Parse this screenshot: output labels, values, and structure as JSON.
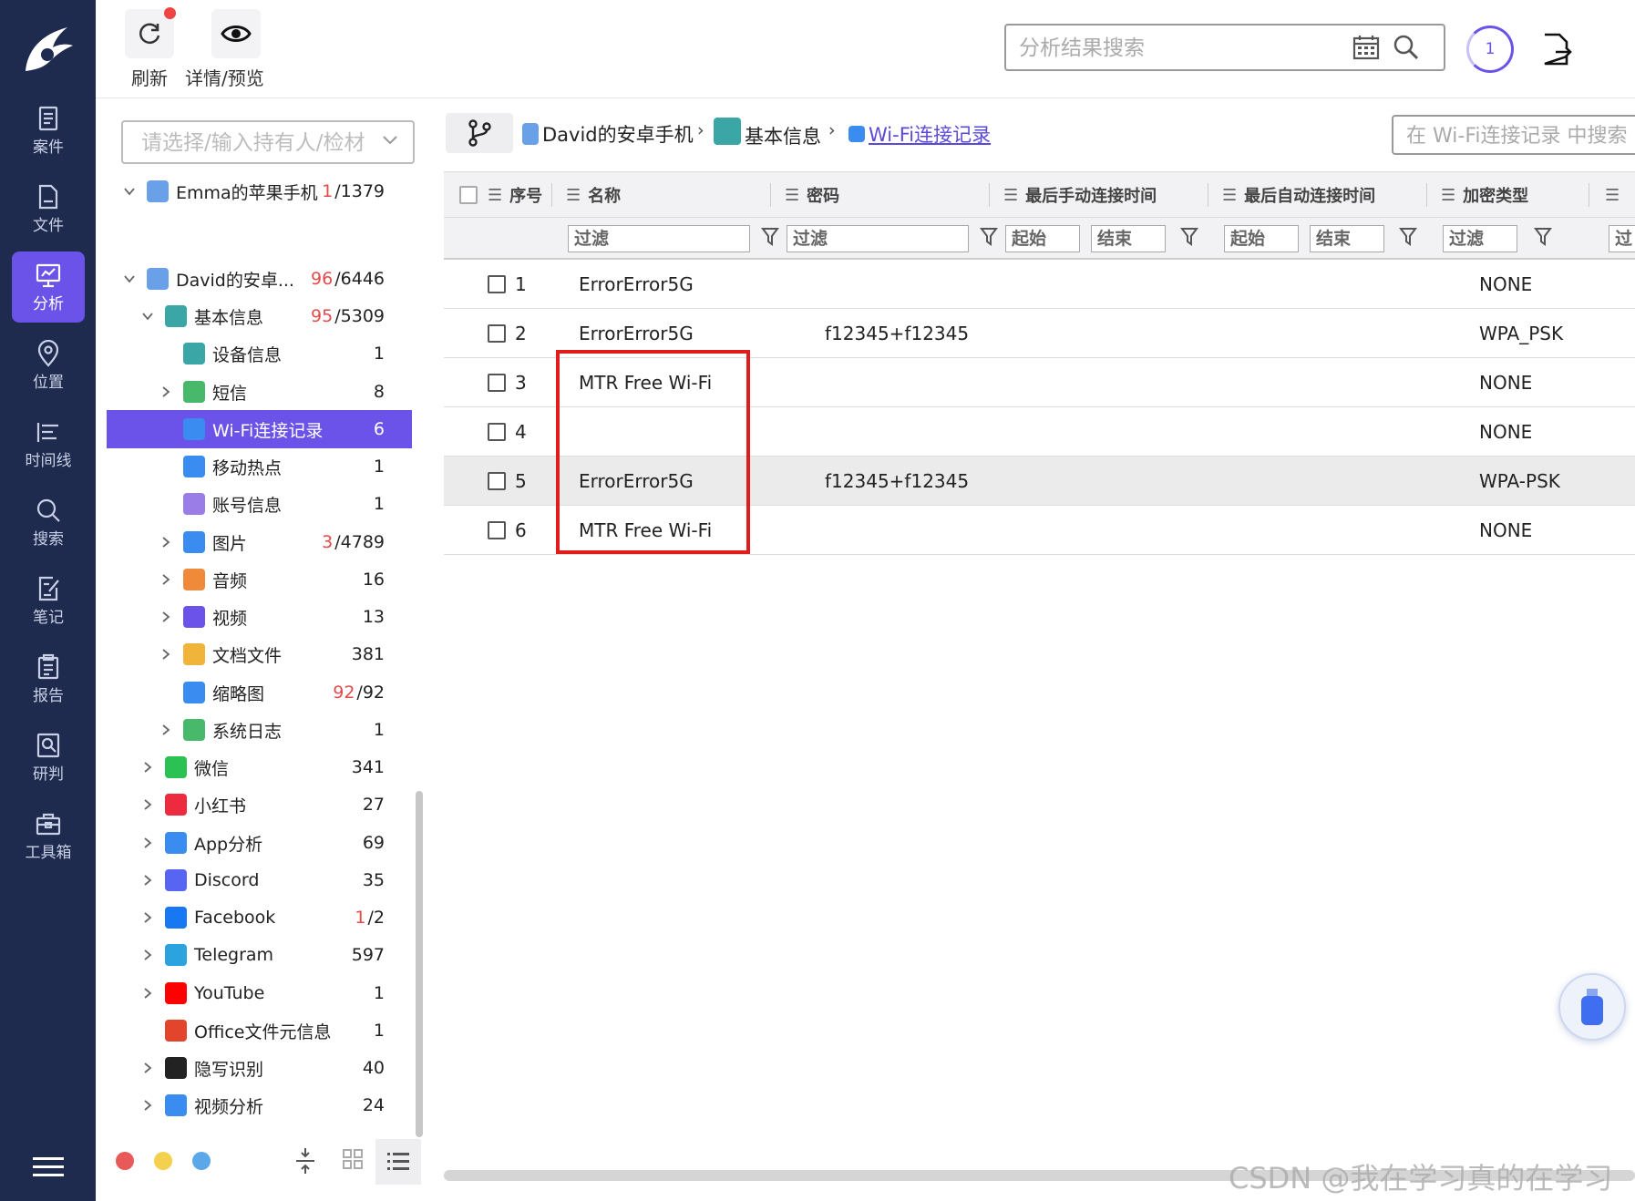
{
  "rail": {
    "items": [
      {
        "label": "案件",
        "icon": "case-icon"
      },
      {
        "label": "文件",
        "icon": "file-icon"
      },
      {
        "label": "分析",
        "icon": "analysis-icon",
        "active": true
      },
      {
        "label": "位置",
        "icon": "location-icon"
      },
      {
        "label": "时间线",
        "icon": "timeline-icon"
      },
      {
        "label": "搜索",
        "icon": "search-icon"
      },
      {
        "label": "笔记",
        "icon": "notes-icon"
      },
      {
        "label": "报告",
        "icon": "report-icon"
      },
      {
        "label": "研判",
        "icon": "judge-icon"
      },
      {
        "label": "工具箱",
        "icon": "toolbox-icon"
      }
    ]
  },
  "toolbar": {
    "refresh_label": "刷新",
    "preview_label": "详情/预览",
    "search_placeholder": "分析结果搜索",
    "task_count": "1"
  },
  "tree": {
    "holder_placeholder": "请选择/输入持有人/检材",
    "rows": [
      {
        "name": "Emma的苹果手机",
        "hit": "1",
        "total": "/1379",
        "level": 0,
        "expanded": true,
        "icon": "phone-doc-icon",
        "iconColor": "#6aa0e8"
      },
      {
        "name": "David的安卓...",
        "hit": "96",
        "total": "/6446",
        "level": 0,
        "expanded": true,
        "icon": "phone-doc-icon",
        "iconColor": "#6aa0e8"
      },
      {
        "name": "基本信息",
        "hit": "95",
        "total": "/5309",
        "level": 1,
        "expanded": true,
        "icon": "basic-info-icon",
        "iconColor": "#3aa6a6"
      },
      {
        "name": "设备信息",
        "hit": "",
        "total": "1",
        "level": 2,
        "icon": "device-info-icon",
        "iconColor": "#3aa6a6"
      },
      {
        "name": "短信",
        "hit": "",
        "total": "8",
        "level": 2,
        "collapsed": true,
        "icon": "sms-icon",
        "iconColor": "#48b86a"
      },
      {
        "name": "Wi-Fi连接记录",
        "hit": "",
        "total": "6",
        "level": 2,
        "selected": true,
        "icon": "wifi-icon",
        "iconColor": "#3b8cf0"
      },
      {
        "name": "移动热点",
        "hit": "",
        "total": "1",
        "level": 2,
        "icon": "hotspot-icon",
        "iconColor": "#3b8cf0"
      },
      {
        "name": "账号信息",
        "hit": "",
        "total": "1",
        "level": 2,
        "icon": "account-icon",
        "iconColor": "#9a7de6"
      },
      {
        "name": "图片",
        "hit": "3",
        "total": "/4789",
        "level": 2,
        "collapsed": true,
        "icon": "image-icon",
        "iconColor": "#3b8cf0"
      },
      {
        "name": "音频",
        "hit": "",
        "total": "16",
        "level": 2,
        "collapsed": true,
        "icon": "audio-icon",
        "iconColor": "#f08a3b"
      },
      {
        "name": "视频",
        "hit": "",
        "total": "13",
        "level": 2,
        "collapsed": true,
        "icon": "video-icon",
        "iconColor": "#6b52e8"
      },
      {
        "name": "文档文件",
        "hit": "",
        "total": "381",
        "level": 2,
        "collapsed": true,
        "icon": "document-icon",
        "iconColor": "#f0b43b"
      },
      {
        "name": "缩略图",
        "hit": "92",
        "total": "/92",
        "level": 2,
        "icon": "thumbnail-icon",
        "iconColor": "#3b8cf0"
      },
      {
        "name": "系统日志",
        "hit": "",
        "total": "1",
        "level": 2,
        "collapsed": true,
        "icon": "syslog-icon",
        "iconColor": "#48b86a"
      },
      {
        "name": "微信",
        "hit": "",
        "total": "341",
        "level": 1,
        "collapsed": true,
        "icon": "wechat-icon",
        "iconColor": "#2bc253"
      },
      {
        "name": "小红书",
        "hit": "",
        "total": "27",
        "level": 1,
        "collapsed": true,
        "icon": "xiaohongshu-icon",
        "iconColor": "#ee2a3e"
      },
      {
        "name": "App分析",
        "hit": "",
        "total": "69",
        "level": 1,
        "collapsed": true,
        "icon": "app-grid-icon",
        "iconColor": "#3b8cf0"
      },
      {
        "name": "Discord",
        "hit": "",
        "total": "35",
        "level": 1,
        "collapsed": true,
        "icon": "discord-icon",
        "iconColor": "#5865f2"
      },
      {
        "name": "Facebook",
        "hit": "1",
        "total": "/2",
        "level": 1,
        "collapsed": true,
        "icon": "facebook-icon",
        "iconColor": "#1877f2"
      },
      {
        "name": "Telegram",
        "hit": "",
        "total": "597",
        "level": 1,
        "collapsed": true,
        "icon": "telegram-icon",
        "iconColor": "#2aa3de"
      },
      {
        "name": "YouTube",
        "hit": "",
        "total": "1",
        "level": 1,
        "collapsed": true,
        "icon": "youtube-icon",
        "iconColor": "#ff0000"
      },
      {
        "name": "Office文件元信息",
        "hit": "",
        "total": "1",
        "level": 1,
        "icon": "office-icon",
        "iconColor": "#e2452b"
      },
      {
        "name": "隐写识别",
        "hit": "",
        "total": "40",
        "level": 1,
        "collapsed": true,
        "icon": "stego-icon",
        "iconColor": "#222222"
      },
      {
        "name": "视频分析",
        "hit": "",
        "total": "24",
        "level": 1,
        "collapsed": true,
        "icon": "video-analysis-icon",
        "iconColor": "#3b8cf0"
      }
    ]
  },
  "breadcrumb": {
    "items": [
      "David的安卓手机",
      "基本信息",
      "Wi-Fi连接记录"
    ],
    "sep": "›",
    "table_search_placeholder": "在 Wi-Fi连接记录 中搜索"
  },
  "table": {
    "columns": [
      "序号",
      "名称",
      "密码",
      "最后手动连接时间",
      "最后自动连接时间",
      "加密类型"
    ],
    "filter_label": "过滤",
    "start_label": "起始",
    "end_label": "结束",
    "rows": [
      {
        "id": "1",
        "name": "ErrorError5G",
        "password": "",
        "manual": "",
        "auto": "",
        "enc": "NONE"
      },
      {
        "id": "2",
        "name": "ErrorError5G",
        "password": "f12345+f12345",
        "manual": "",
        "auto": "",
        "enc": "WPA_PSK"
      },
      {
        "id": "3",
        "name": "MTR Free Wi-Fi",
        "password": "",
        "manual": "",
        "auto": "",
        "enc": "NONE"
      },
      {
        "id": "4",
        "name": "",
        "password": "",
        "manual": "",
        "auto": "",
        "enc": "NONE"
      },
      {
        "id": "5",
        "name": "ErrorError5G",
        "password": "f12345+f12345",
        "manual": "",
        "auto": "",
        "enc": "WPA-PSK",
        "hover": true
      },
      {
        "id": "6",
        "name": "MTR Free Wi-Fi",
        "password": "",
        "manual": "",
        "auto": "",
        "enc": "NONE"
      }
    ]
  },
  "colors": {
    "rail_bg": "#1e2a4e",
    "accent": "#6b52e8",
    "highlight": "#e01c1c",
    "hit_count": "#e34b4b"
  },
  "watermark": "CSDN @我在学习真的在学习"
}
